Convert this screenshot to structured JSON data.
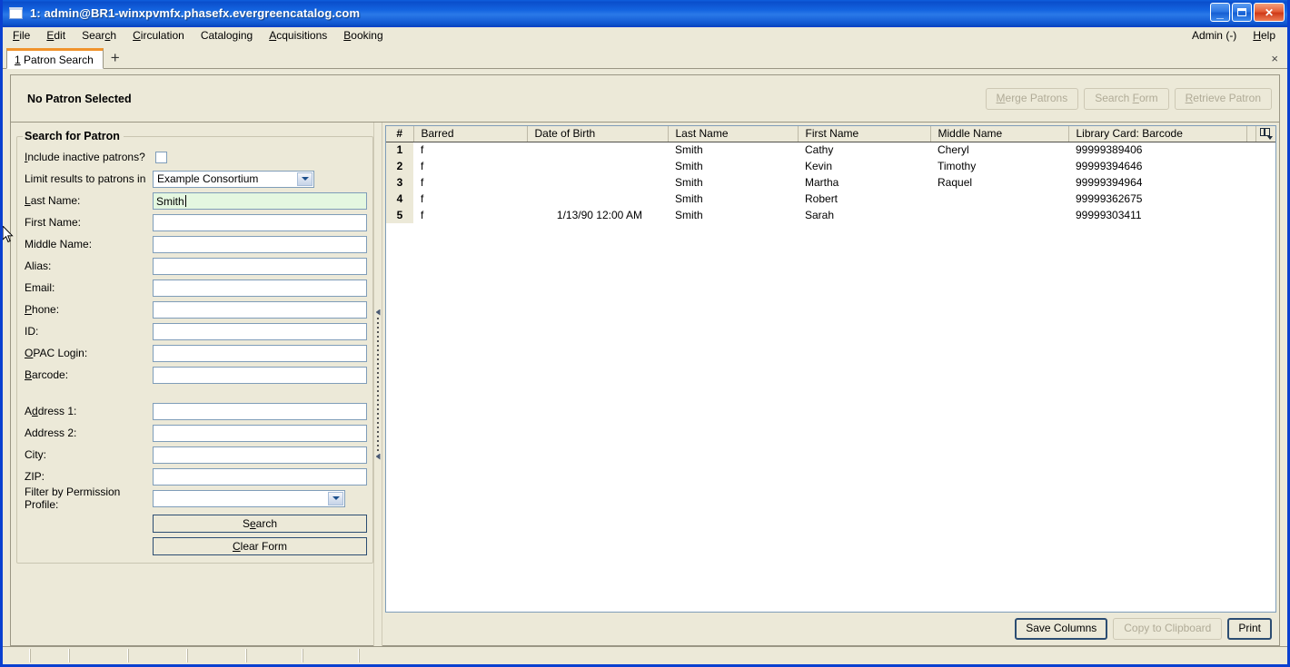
{
  "window": {
    "title": "1: admin@BR1-winxpvmfx.phasefx.evergreencatalog.com",
    "icon": "window-icon",
    "minimize": "_",
    "maximize": "",
    "close": "✕"
  },
  "menubar": {
    "items": [
      {
        "label": "File",
        "accel": "F"
      },
      {
        "label": "Edit",
        "accel": "E"
      },
      {
        "label": "Search",
        "accel": "c"
      },
      {
        "label": "Circulation",
        "accel": "C"
      },
      {
        "label": "Cataloging",
        "accel": "g"
      },
      {
        "label": "Acquisitions",
        "accel": "A"
      },
      {
        "label": "Booking",
        "accel": "B"
      }
    ],
    "right": [
      {
        "label": "Admin (-)",
        "accel": ""
      },
      {
        "label": "Help",
        "accel": "H"
      }
    ]
  },
  "tabs": {
    "active": {
      "index": "1",
      "label": "Patron Search"
    },
    "add_label": "+",
    "close_label": "×"
  },
  "patron_bar": {
    "status": "No Patron Selected",
    "buttons": [
      {
        "label": "Merge Patrons",
        "accel": "M",
        "disabled": true
      },
      {
        "label": "Search Form",
        "accel": "F",
        "disabled": true
      },
      {
        "label": "Retrieve Patron",
        "accel": "R",
        "disabled": true
      }
    ]
  },
  "search_form": {
    "legend": "Search for Patron",
    "include_inactive": {
      "label": "Include inactive patrons?",
      "accel": "I",
      "checked": false
    },
    "limit_results": {
      "label": "Limit results to patrons in",
      "value": "Example Consortium",
      "options": [
        "Example Consortium"
      ]
    },
    "fields": [
      {
        "label": "Last Name:",
        "accel": "L",
        "value": "Smith",
        "filled": true
      },
      {
        "label": "First Name:",
        "accel": "",
        "value": "",
        "filled": false
      },
      {
        "label": "Middle Name:",
        "accel": "",
        "value": "",
        "filled": false
      },
      {
        "label": "Alias:",
        "accel": "",
        "value": "",
        "filled": false
      },
      {
        "label": "Email:",
        "accel": "",
        "value": "",
        "filled": false
      },
      {
        "label": "Phone:",
        "accel": "P",
        "value": "",
        "filled": false
      },
      {
        "label": "ID:",
        "accel": "",
        "value": "",
        "filled": false
      },
      {
        "label": "OPAC Login:",
        "accel": "O",
        "value": "",
        "filled": false
      },
      {
        "label": "Barcode:",
        "accel": "B",
        "value": "",
        "filled": false
      }
    ],
    "address_fields": [
      {
        "label": "Address 1:",
        "accel": "d",
        "value": "",
        "filled": false
      },
      {
        "label": "Address 2:",
        "accel": "",
        "value": "",
        "filled": false
      },
      {
        "label": "City:",
        "accel": "",
        "value": "",
        "filled": false
      },
      {
        "label": "ZIP:",
        "accel": "",
        "value": "",
        "filled": false
      }
    ],
    "permission_profile": {
      "label": "Filter by Permission Profile:",
      "value": "",
      "options": []
    },
    "search_button": {
      "label": "Search",
      "accel": "e"
    },
    "clear_button": {
      "label": "Clear Form",
      "accel": "C"
    }
  },
  "results": {
    "columns": [
      "#",
      "Barred",
      "Date of Birth",
      "Last Name",
      "First Name",
      "Middle Name",
      "Library Card: Barcode"
    ],
    "column_picker_icon": "column-picker-icon",
    "rows": [
      {
        "num": "1",
        "barred": "f",
        "dob": "",
        "last": "Smith",
        "first": "Cathy",
        "middle": "Cheryl",
        "barcode": "99999389406"
      },
      {
        "num": "2",
        "barred": "f",
        "dob": "",
        "last": "Smith",
        "first": "Kevin",
        "middle": "Timothy",
        "barcode": "99999394646"
      },
      {
        "num": "3",
        "barred": "f",
        "dob": "",
        "last": "Smith",
        "first": "Martha",
        "middle": "Raquel",
        "barcode": "99999394964"
      },
      {
        "num": "4",
        "barred": "f",
        "dob": "",
        "last": "Smith",
        "first": "Robert",
        "middle": "",
        "barcode": "99999362675"
      },
      {
        "num": "5",
        "barred": "f",
        "dob": "1/13/90 12:00 AM",
        "last": "Smith",
        "first": "Sarah",
        "middle": "",
        "barcode": "99999303411"
      }
    ],
    "footer_buttons": [
      {
        "label": "Save Columns",
        "disabled": false,
        "default": true
      },
      {
        "label": "Copy to Clipboard",
        "disabled": true,
        "default": false
      },
      {
        "label": "Print",
        "disabled": false,
        "default": true
      }
    ]
  },
  "statusbar": {
    "cells": [
      "",
      "",
      "",
      "",
      "",
      "",
      "",
      ""
    ]
  },
  "colors": {
    "window_border": "#0a40d0",
    "face": "#ece9d8",
    "field_border": "#7f9db9",
    "filled_field": "#e4f7e0",
    "tab_accent": "#f0932b"
  }
}
